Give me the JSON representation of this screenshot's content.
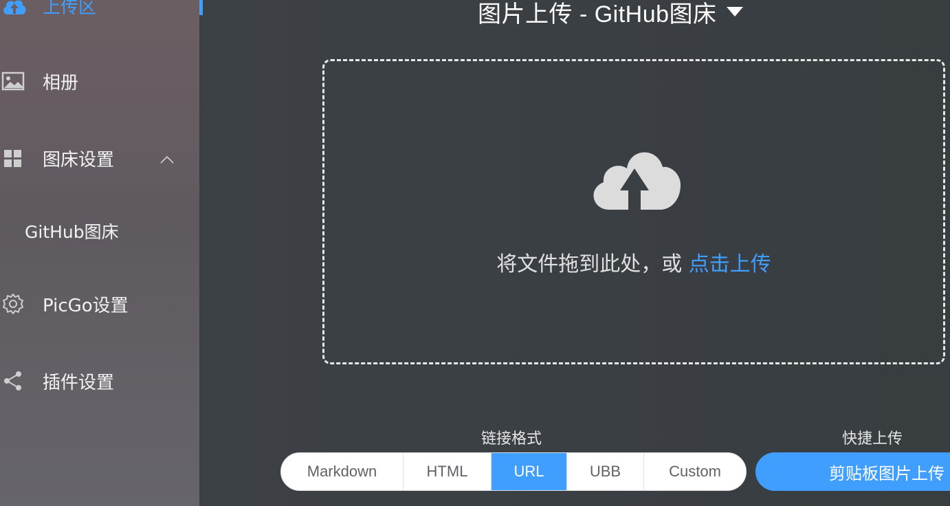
{
  "sidebar": {
    "items": [
      {
        "label": "上传区",
        "icon": "cloud-upload-icon"
      },
      {
        "label": "相册",
        "icon": "image-icon"
      },
      {
        "label": "图床设置",
        "icon": "grid-icon"
      },
      {
        "label": "PicGo设置",
        "icon": "gear-icon"
      },
      {
        "label": "插件设置",
        "icon": "share-icon"
      }
    ],
    "submenu": {
      "label": "GitHub图床"
    }
  },
  "main": {
    "title": "图片上传 - GitHub图床",
    "dropzone": {
      "hint": "将文件拖到此处，或 ",
      "link": "点击上传"
    },
    "link_format": {
      "label": "链接格式",
      "options": [
        "Markdown",
        "HTML",
        "URL",
        "UBB",
        "Custom"
      ],
      "selected": "URL"
    },
    "quick_upload": {
      "label": "快捷上传",
      "button": "剪贴板图片上传"
    }
  },
  "colors": {
    "accent": "#409eff",
    "background": "#3a3f44"
  }
}
